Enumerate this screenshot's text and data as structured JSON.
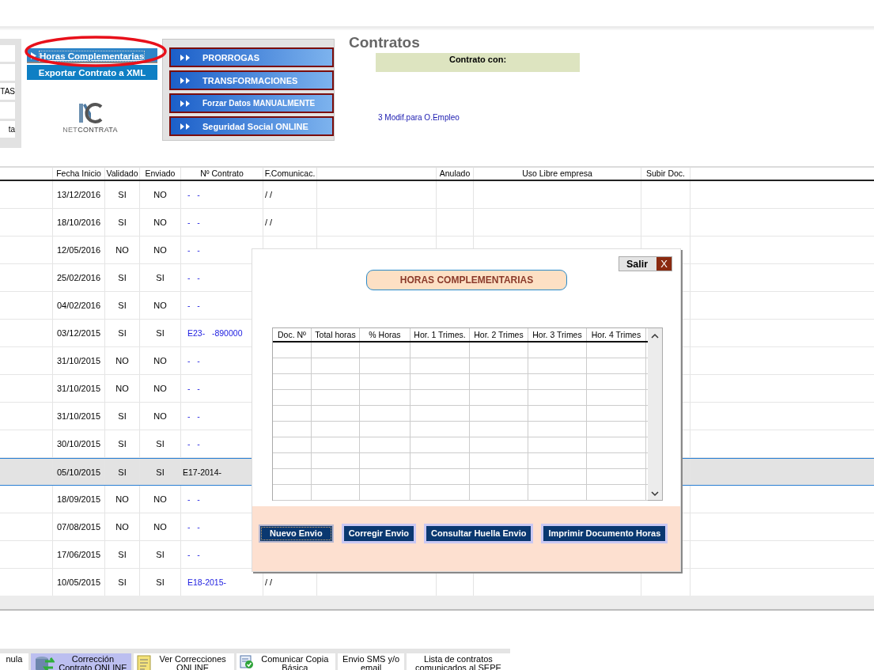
{
  "left_panel": {
    "buttons": [
      {
        "kind": "blank"
      },
      {
        "kind": "blank"
      },
      {
        "kind": "text",
        "label": "TAS"
      },
      {
        "kind": "blank"
      },
      {
        "kind": "text",
        "label": "ta"
      }
    ]
  },
  "links": [
    {
      "label": "Horas Complementarias",
      "highlighted": true
    },
    {
      "label": "Exportar Contrato a XML",
      "highlighted": false
    }
  ],
  "logo": {
    "text": "NET**CONTRATA**"
  },
  "actions": [
    "PRORROGAS",
    "TRANSFORMACIONES",
    "Forzar Datos MANUALMENTE",
    "Seguridad Social ONLINE"
  ],
  "title": "Contratos",
  "contrato_con": "Contrato con:",
  "modif_link": "3 Modif.para O.Empleo",
  "table": {
    "columns": [
      {},
      {
        "label": "Fecha Inicio"
      },
      {
        "label": "Validado"
      },
      {
        "label": "Enviado"
      },
      {
        "label": "Nº Contrato"
      },
      {
        "label": "F.Comunicac."
      },
      {},
      {
        "label": "Anulado"
      },
      {
        "label": "Uso Libre empresa"
      },
      {
        "label": "Subir Doc."
      }
    ],
    "rows": [
      {
        "fecha": "13/12/2016",
        "validado": "SI",
        "enviado": "NO",
        "contrato": "-   -",
        "f_comunicac": "/ /",
        "selected": false
      },
      {
        "fecha": "18/10/2016",
        "validado": "SI",
        "enviado": "NO",
        "contrato": "-   -",
        "f_comunicac": "/ /",
        "selected": false
      },
      {
        "fecha": "12/05/2016",
        "validado": "NO",
        "enviado": "NO",
        "contrato": "-   -",
        "selected": false
      },
      {
        "fecha": "25/02/2016",
        "validado": "SI",
        "enviado": "SI",
        "contrato": "-   -",
        "selected": false
      },
      {
        "fecha": "04/02/2016",
        "validado": "SI",
        "enviado": "NO",
        "contrato": "-   -",
        "selected": false
      },
      {
        "fecha": "03/12/2015",
        "validado": "SI",
        "enviado": "SI",
        "contrato": "E23-   -890000",
        "selected": false
      },
      {
        "fecha": "31/10/2015",
        "validado": "NO",
        "enviado": "NO",
        "contrato": "-   -",
        "selected": false
      },
      {
        "fecha": "31/10/2015",
        "validado": "NO",
        "enviado": "NO",
        "contrato": "-   -",
        "selected": false
      },
      {
        "fecha": "31/10/2015",
        "validado": "SI",
        "enviado": "NO",
        "contrato": "-   -",
        "selected": false
      },
      {
        "fecha": "30/10/2015",
        "validado": "SI",
        "enviado": "SI",
        "contrato": "-   -",
        "selected": false
      },
      {
        "fecha": "05/10/2015",
        "validado": "SI",
        "enviado": "SI",
        "contrato": "E17-2014-",
        "selected": true
      },
      {
        "fecha": "18/09/2015",
        "validado": "NO",
        "enviado": "NO",
        "contrato": "-   -",
        "selected": false
      },
      {
        "fecha": "07/08/2015",
        "validado": "NO",
        "enviado": "NO",
        "contrato": "-   -",
        "selected": false
      },
      {
        "fecha": "17/06/2015",
        "validado": "SI",
        "enviado": "SI",
        "contrato": "-   -",
        "selected": false
      },
      {
        "fecha": "10/05/2015",
        "validado": "SI",
        "enviado": "SI",
        "contrato": "E18-2015-",
        "f_comunicac": "/ /",
        "selected": false
      }
    ]
  },
  "dialog": {
    "salir": "Salir",
    "close": "X",
    "title": "HORAS COMPLEMENTARIAS",
    "columns": [
      "Doc. Nº",
      "Total horas",
      "% Horas",
      "Hor. 1 Trimes.",
      "Hor. 2 Trimes",
      "Hor. 3 Trimes",
      "Hor. 4 Trimes"
    ],
    "buttons": [
      {
        "label": "Nuevo Envio",
        "focused": true
      },
      {
        "label": "Corregir Envio",
        "focused": false
      },
      {
        "label": "Consultar Huella Envio",
        "focused": false
      },
      {
        "label": "Imprimir Documento Horas",
        "focused": false
      }
    ]
  },
  "toolbar": [
    {
      "label": "nula",
      "selected": false
    },
    {
      "label": "Corrección Contrato ONLINE",
      "selected": true
    },
    {
      "label": "Ver Correcciones ONLINE",
      "selected": false
    },
    {
      "label": "Comunicar Copia Básica",
      "selected": false
    },
    {
      "label": "Envio SMS y/o email",
      "selected": false
    },
    {
      "label": "Lista de contratos comunicados al SEPE",
      "selected": false
    }
  ]
}
